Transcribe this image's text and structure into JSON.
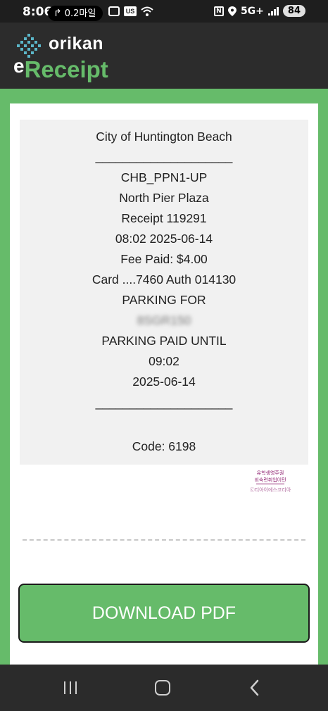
{
  "status_bar": {
    "time": "8:06",
    "nav_distance": "0.2마일",
    "us_badge": "US",
    "network": "5G+",
    "battery": "84"
  },
  "header": {
    "brand": "orikan",
    "title_prefix": "e",
    "title": "Receipt",
    "brand_color": "#66bb6a",
    "header_bg": "#2c2c2c"
  },
  "receipt": {
    "merchant": "City of Huntington Beach",
    "divider": "____________________",
    "terminal_id": "CHB_PPN1-UP",
    "location": "North Pier Plaza",
    "receipt_number": "Receipt 119291",
    "datetime": "08:02 2025-06-14",
    "fee": "Fee Paid: $4.00",
    "card": "Card ....7460 Auth 014130",
    "parking_for_label": "PARKING FOR",
    "plate": "8SGR150",
    "paid_until_label": "PARKING PAID UNTIL",
    "paid_until_time": "09:02",
    "paid_until_date": "2025-06-14",
    "divider_bottom": "____________________",
    "code": "Code: 6198"
  },
  "watermark": {
    "line1": "유학생영주권",
    "line2": "비숙련취업이민",
    "line3": "ⓒ티아이에스코리아"
  },
  "actions": {
    "download_label": "DOWNLOAD PDF"
  },
  "icons": [
    "navigation-arrow-icon",
    "screenshot-icon",
    "wifi-icon",
    "nfc-icon",
    "location-icon",
    "signal-icon",
    "battery-icon",
    "orikan-logo-icon",
    "recent-apps-icon",
    "home-icon",
    "back-icon"
  ]
}
